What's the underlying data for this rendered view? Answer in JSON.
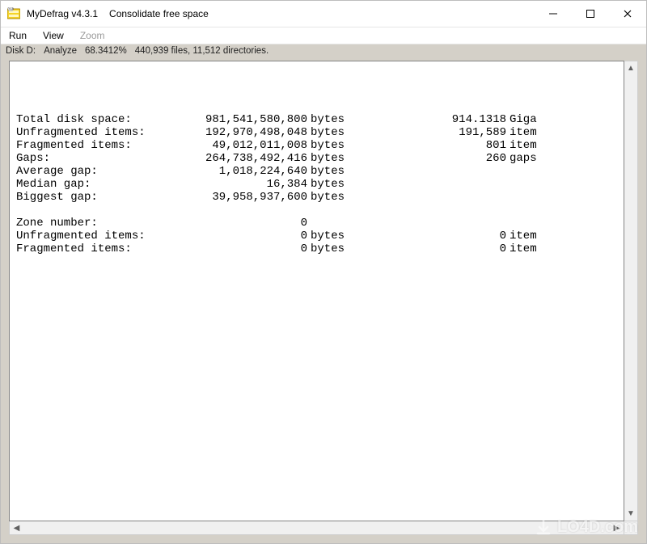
{
  "titlebar": {
    "app_name": "MyDefrag v4.3.1",
    "subtitle": "Consolidate free space",
    "icon_name": "mydefrag-icon"
  },
  "menu": {
    "run": "Run",
    "view": "View",
    "zoom": "Zoom"
  },
  "status": {
    "disk": "Disk D:",
    "mode": "Analyze",
    "percent": "68.3412%",
    "files_dirs": "440,939 files, 11,512 directories."
  },
  "report": {
    "section_disk": [
      {
        "label": "Total disk space:",
        "v1": "981,541,580,800",
        "u1": "bytes",
        "v2": "914.1318",
        "u2": "Giga"
      },
      {
        "label": "Unfragmented items:",
        "v1": "192,970,498,048",
        "u1": "bytes",
        "v2": "191,589",
        "u2": "item"
      },
      {
        "label": "Fragmented items:",
        "v1": "49,012,011,008",
        "u1": "bytes",
        "v2": "801",
        "u2": "item"
      },
      {
        "label": "Gaps:",
        "v1": "264,738,492,416",
        "u1": "bytes",
        "v2": "260",
        "u2": "gaps"
      },
      {
        "label": "Average gap:",
        "v1": "1,018,224,640",
        "u1": "bytes",
        "v2": "",
        "u2": ""
      },
      {
        "label": "Median gap:",
        "v1": "16,384",
        "u1": "bytes",
        "v2": "",
        "u2": ""
      },
      {
        "label": "Biggest gap:",
        "v1": "39,958,937,600",
        "u1": "bytes",
        "v2": "",
        "u2": ""
      }
    ],
    "section_zone": [
      {
        "label": "Zone number:",
        "v1": "0",
        "u1": "",
        "v2": "",
        "u2": ""
      },
      {
        "label": "Unfragmented items:",
        "v1": "0",
        "u1": "bytes",
        "v2": "0",
        "u2": "item"
      },
      {
        "label": "Fragmented items:",
        "v1": "0",
        "u1": "bytes",
        "v2": "0",
        "u2": "item"
      }
    ]
  },
  "watermark": {
    "text": "LO4D.com"
  }
}
